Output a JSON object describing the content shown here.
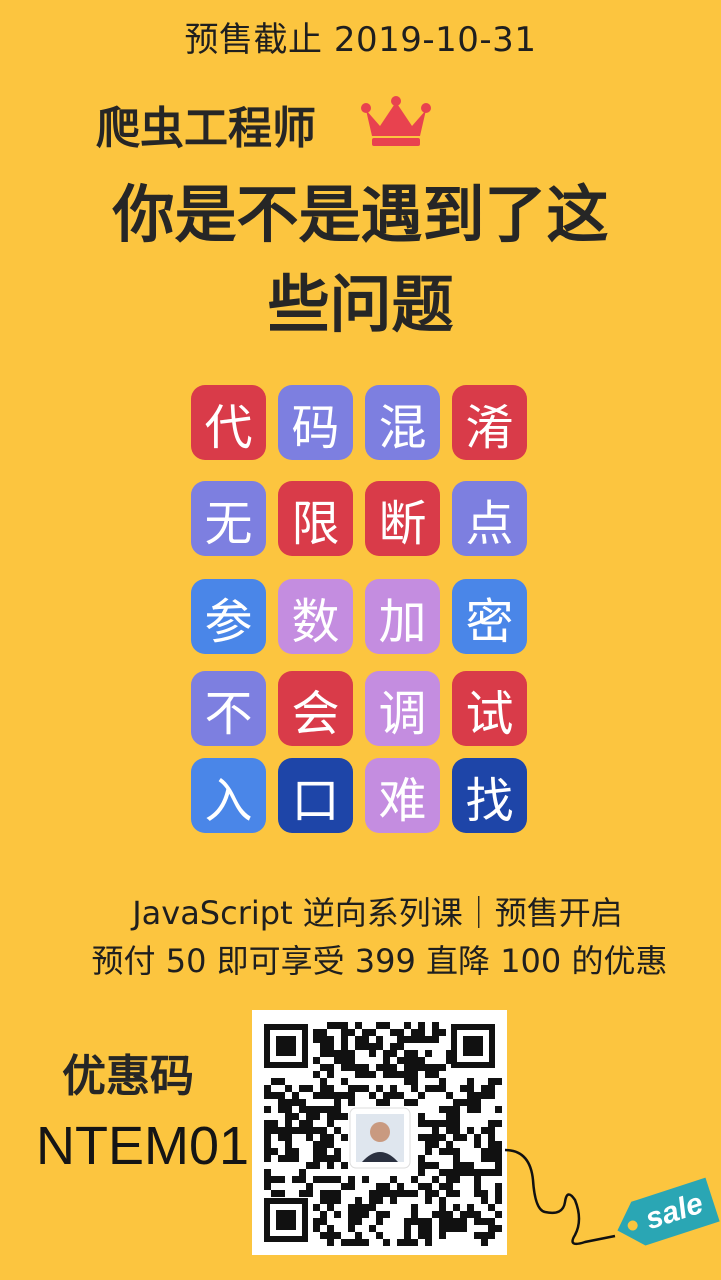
{
  "header": {
    "presale_deadline": "预售截止 2019-10-31",
    "role": "爬虫工程师",
    "crown_icon": "crown-icon",
    "headline_line1": "你是不是遇到了这",
    "headline_line2": "些问题"
  },
  "colors": {
    "background": "#fcc53f",
    "red": "#d93b49",
    "purple": "#7d7fe0",
    "blue": "#4a86e8",
    "lavender": "#c48de0",
    "navy": "#1e45a8",
    "sale_tag": "#2aa6b4"
  },
  "tiles": [
    [
      "代",
      "码",
      "混",
      "淆"
    ],
    [
      "无",
      "限",
      "断",
      "点"
    ],
    [
      "参",
      "数",
      "加",
      "密"
    ],
    [
      "不",
      "会",
      "调",
      "试"
    ],
    [
      "入",
      "口",
      "难",
      "找"
    ]
  ],
  "promo": {
    "line1": "JavaScript 逆向系列课｜预售开启",
    "line2": "预付 50 即可享受 399 直降 100 的优惠"
  },
  "coupon": {
    "label": "优惠码",
    "code": "NTEM01"
  },
  "sale_tag": {
    "text": "sale",
    "icon": "sale-tag-icon"
  },
  "qr": {
    "icon": "qr-code-icon"
  }
}
